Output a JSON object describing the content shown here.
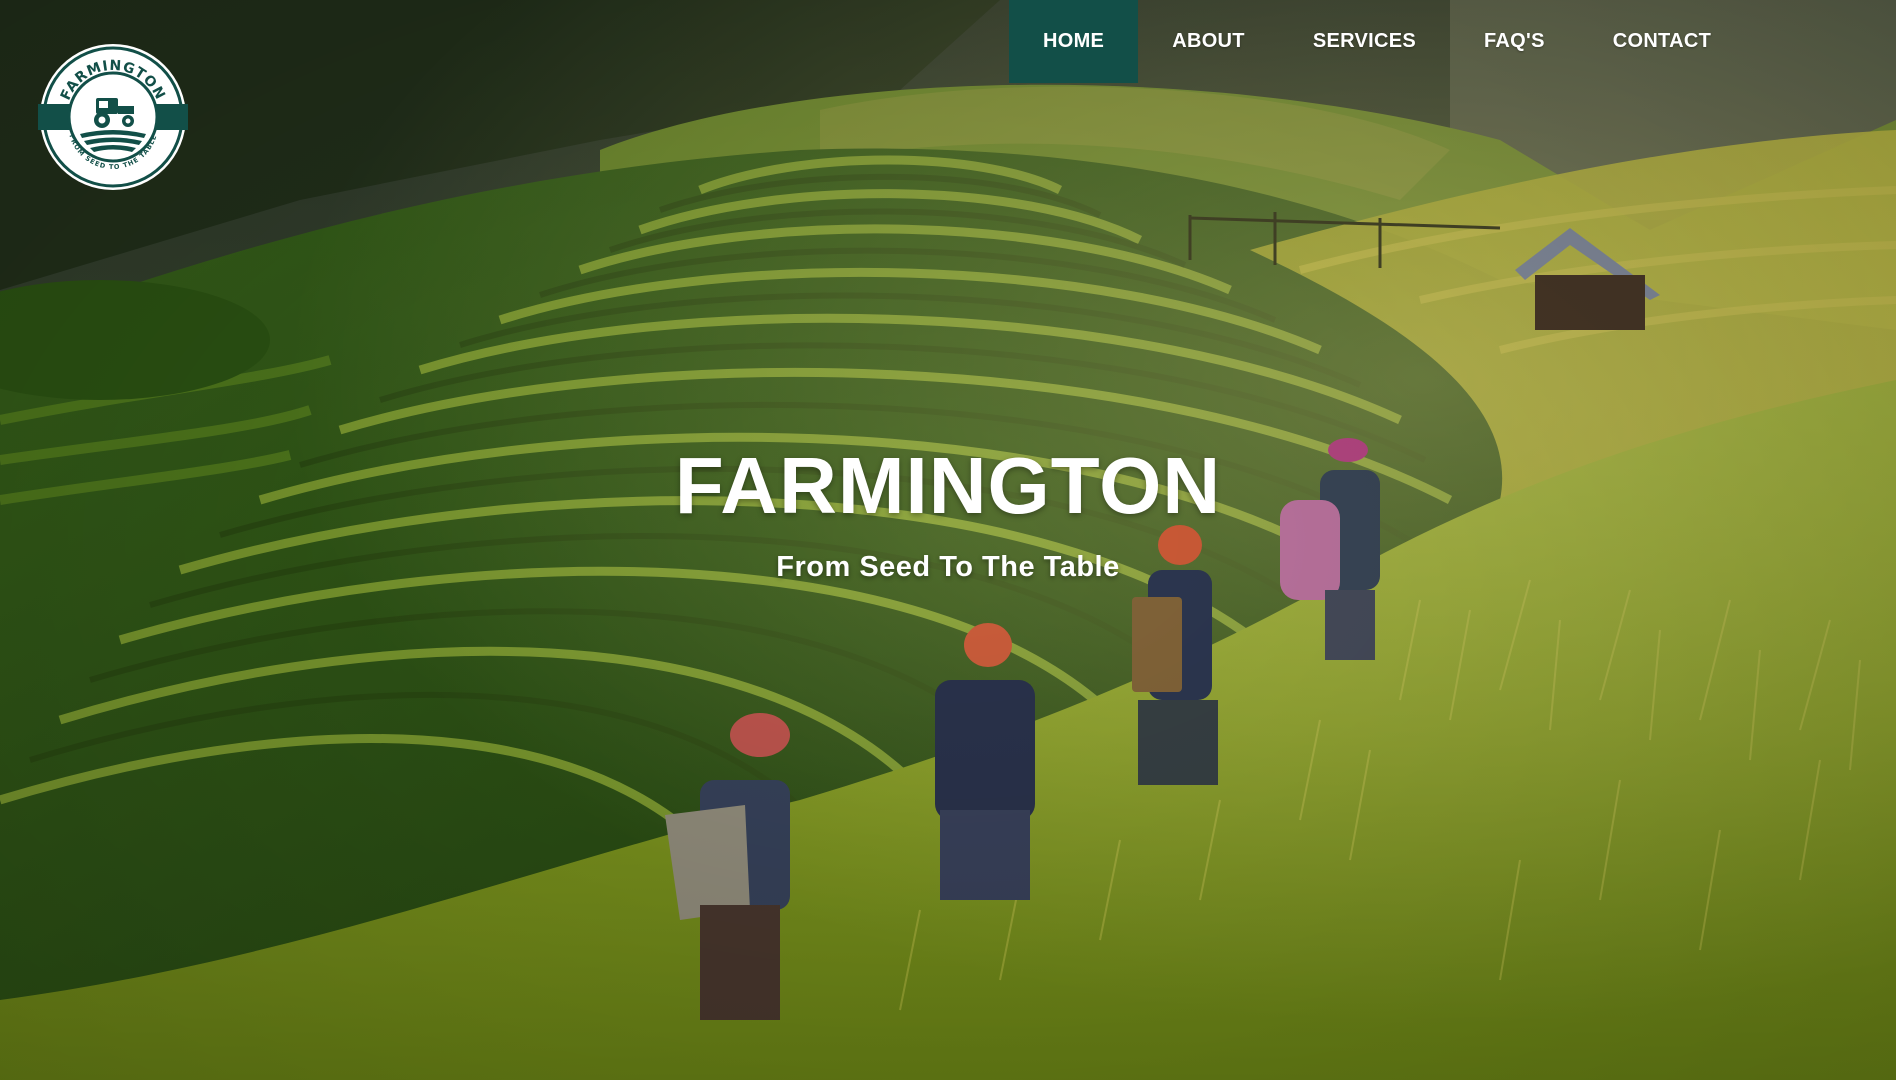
{
  "brand": {
    "logo_name": "FARMINGTON",
    "logo_tagline": "FROM SEED TO THE TABLE"
  },
  "nav": {
    "items": [
      {
        "label": "HOME",
        "active": true
      },
      {
        "label": "ABOUT",
        "active": false
      },
      {
        "label": "SERVICES",
        "active": false
      },
      {
        "label": "FAQ'S",
        "active": false
      },
      {
        "label": "CONTACT",
        "active": false
      }
    ],
    "active_color": "#124f48"
  },
  "hero": {
    "title": "FARMINGTON",
    "subtitle": "From Seed To The Table",
    "background": "rice-terrace-photo"
  },
  "colors": {
    "brand_green": "#124f48",
    "text": "#ffffff"
  }
}
